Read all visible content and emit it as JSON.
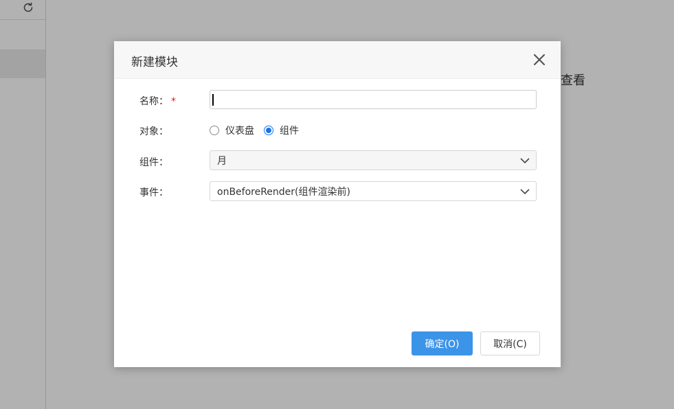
{
  "background": {
    "right_text": "查看"
  },
  "dialog": {
    "title": "新建模块",
    "form": {
      "name": {
        "label": "名称：",
        "required_mark": "*",
        "value": ""
      },
      "object": {
        "label": "对象：",
        "options": [
          "仪表盘",
          "组件"
        ],
        "selected": "组件"
      },
      "component": {
        "label": "组件：",
        "value": "月"
      },
      "event": {
        "label": "事件：",
        "value": "onBeforeRender(组件渲染前)"
      }
    },
    "buttons": {
      "confirm_label": "确定(O)",
      "cancel_label": "取消(C)"
    }
  },
  "colors": {
    "primary": "#3c94e8",
    "radio_checked": "#1a73e8",
    "required": "#e02020"
  },
  "icons": {
    "refresh": "refresh-icon",
    "close": "close-icon",
    "dropdown": "chevron-down-icon"
  }
}
